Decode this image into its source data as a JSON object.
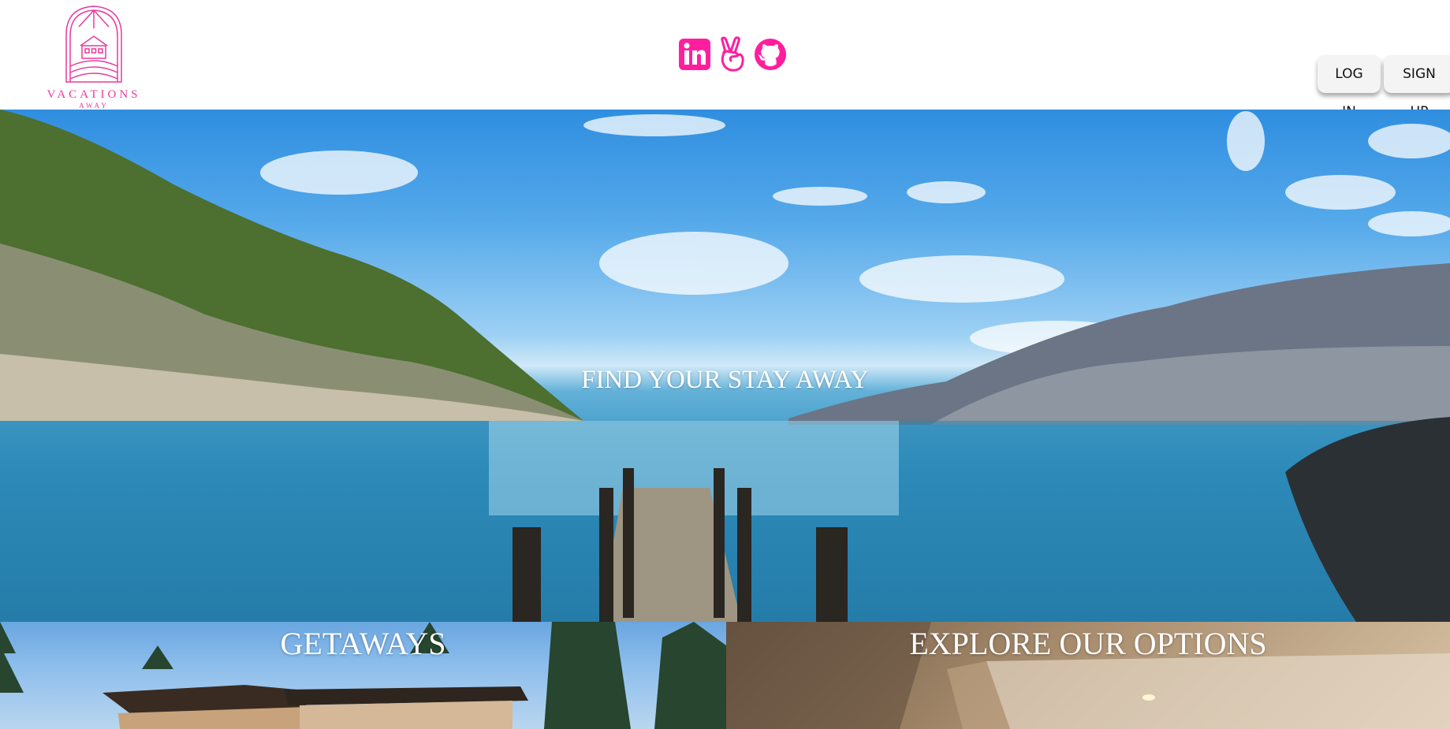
{
  "brand": {
    "name": "VACATIONS",
    "tagline": "AWAY",
    "accent": "#FF1F9E"
  },
  "header": {
    "socials": [
      {
        "name": "linkedin-icon"
      },
      {
        "name": "angellist-icon"
      },
      {
        "name": "github-icon"
      }
    ],
    "login_label": "LOG IN",
    "signup_label": "SIGN UP"
  },
  "hero": {
    "title": "FIND YOUR STAY AWAY"
  },
  "tiles": [
    {
      "title": "GETAWAYS"
    },
    {
      "title": "EXPLORE OUR OPTIONS"
    }
  ]
}
